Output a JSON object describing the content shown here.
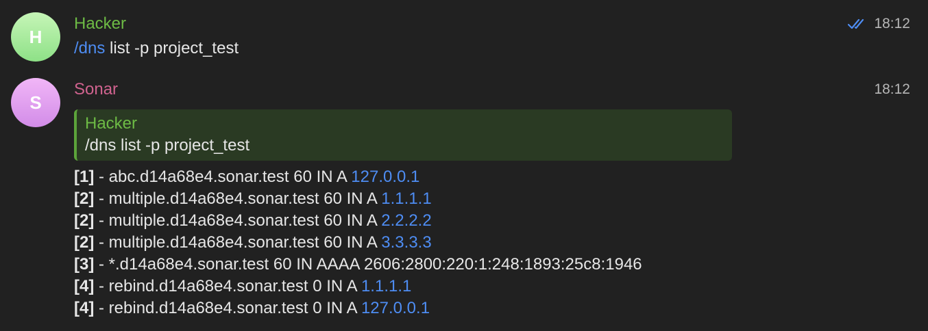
{
  "messages": [
    {
      "sender": "Hacker",
      "avatar_letter": "H",
      "time": "18:12",
      "read_status": "double-check-icon",
      "command": "/dns",
      "args": " list -p project_test"
    },
    {
      "sender": "Sonar",
      "avatar_letter": "S",
      "time": "18:12",
      "reply_to": {
        "author": "Hacker",
        "text": "/dns list -p project_test"
      },
      "records": [
        {
          "index": "[1]",
          "rest": " - abc.d14a68e4.sonar.test 60 IN A ",
          "value": "127.0.0.1"
        },
        {
          "index": "[2]",
          "rest": " - multiple.d14a68e4.sonar.test 60 IN A ",
          "value": "1.1.1.1"
        },
        {
          "index": "[2]",
          "rest": " - multiple.d14a68e4.sonar.test 60 IN A ",
          "value": "2.2.2.2"
        },
        {
          "index": "[2]",
          "rest": " - multiple.d14a68e4.sonar.test 60 IN A ",
          "value": "3.3.3.3"
        },
        {
          "index": "[3]",
          "rest": " - *.d14a68e4.sonar.test 60 IN AAAA 2606:2800:220:1:248:1893:25c8:1946",
          "value": ""
        },
        {
          "index": "[4]",
          "rest": " - rebind.d14a68e4.sonar.test 0 IN A ",
          "value": "1.1.1.1"
        },
        {
          "index": "[4]",
          "rest": " - rebind.d14a68e4.sonar.test 0 IN A ",
          "value": "127.0.0.1"
        }
      ]
    }
  ],
  "colors": {
    "background": "#212121",
    "hacker_name": "#6dbb45",
    "sonar_name": "#d0638f",
    "link": "#4e8df3",
    "quote_bg": "#2a3a23",
    "quote_border": "#5ca43a"
  }
}
